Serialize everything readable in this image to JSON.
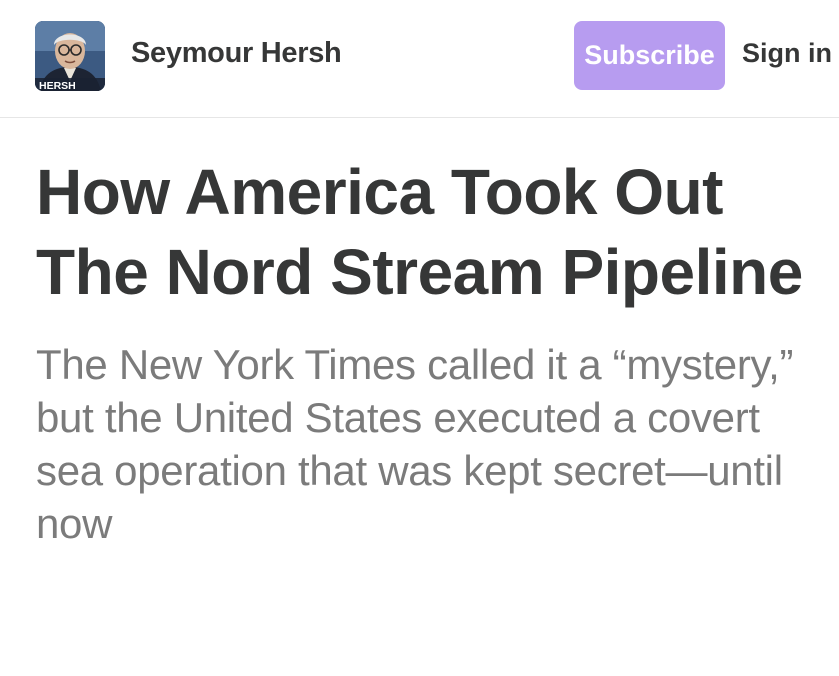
{
  "header": {
    "publication_name": "Seymour Hersh",
    "avatar_caption": "HERSH",
    "subscribe_label": "Subscribe",
    "signin_label": "Sign in"
  },
  "article": {
    "title": "How America Took Out The Nord Stream Pipeline",
    "subtitle": "The New York Times called it a “mystery,” but the United States executed a covert sea operation that was kept secret—until now"
  },
  "colors": {
    "accent": "#b79cf0",
    "heading_text": "#363737",
    "subtitle_text": "#7b7b7b",
    "background": "#ffffff"
  }
}
